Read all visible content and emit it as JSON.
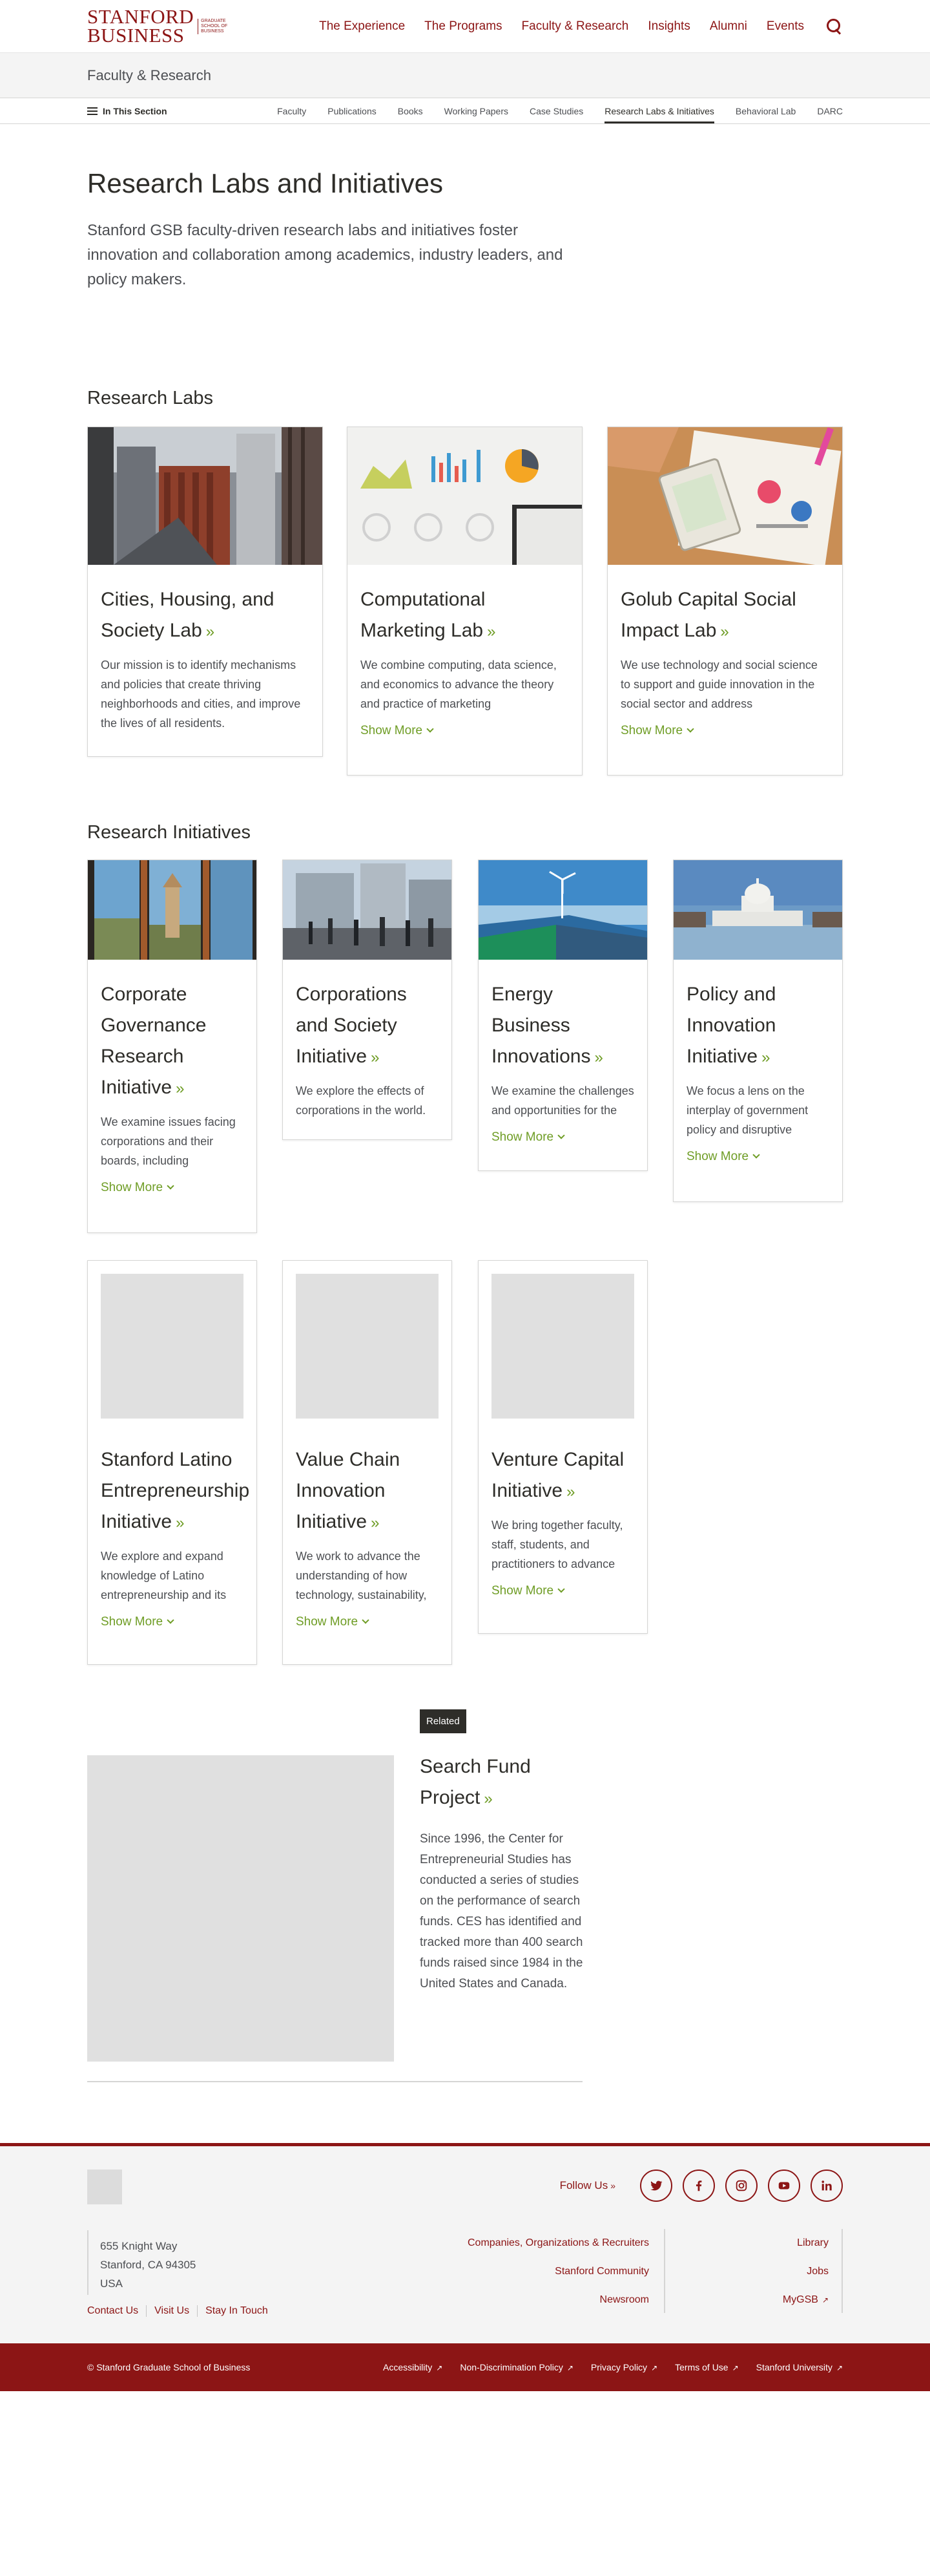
{
  "header": {
    "logo_line1": "STANFORD",
    "logo_line2": "BUSINESS",
    "logo_sub1": "Graduate",
    "logo_sub2": "School of",
    "logo_sub3": "Business",
    "nav": [
      "The Experience",
      "The Programs",
      "Faculty & Research",
      "Insights",
      "Alumni",
      "Events"
    ]
  },
  "section": {
    "title": "Faculty & Research"
  },
  "subnav": {
    "in_section": "In This Section",
    "links": [
      "Faculty",
      "Publications",
      "Books",
      "Working Papers",
      "Case Studies",
      "Research Labs & Initiatives",
      "Behavioral Lab",
      "DARC"
    ],
    "active_index": 5
  },
  "page": {
    "title": "Research Labs and Initiatives",
    "intro": "Stanford GSB faculty-driven research labs and initiatives foster innovation and collaboration among academics, industry leaders, and policy makers."
  },
  "labs": {
    "heading": "Research Labs",
    "items": [
      {
        "title": "Cities, Housing, and Society Lab",
        "text": "Our mission is to identify mechanisms and policies that create thriving neighborhoods and cities, and improve the lives of all residents.",
        "show_more": ""
      },
      {
        "title": "Computational Marketing Lab",
        "text": "We combine computing, data science, and economics to advance the theory and practice of marketing",
        "show_more": "Show More"
      },
      {
        "title": "Golub Capital Social Impact Lab",
        "text": "We use technology and social science to support and guide innovation in the social sector and address",
        "show_more": "Show More"
      }
    ]
  },
  "initiatives": {
    "heading": "Research Initiatives",
    "items": [
      {
        "title": "Corporate Governance Research Initiative",
        "text": "We examine issues facing corporations and their boards, including",
        "show_more": "Show More"
      },
      {
        "title": "Corporations and Society Initiative",
        "text": "We explore the effects of corporations in the world.",
        "show_more": ""
      },
      {
        "title": "Energy Business Innovations",
        "text": "We examine the challenges and opportunities for the",
        "show_more": "Show More"
      },
      {
        "title": "Policy and Innovation Initiative",
        "text": "We focus a lens on the interplay of government policy and disruptive",
        "show_more": "Show More"
      },
      {
        "title": "Stanford Latino Entrepreneurship Initiative",
        "text": "We explore and expand knowledge of Latino entrepreneurship and its",
        "show_more": "Show More"
      },
      {
        "title": "Value Chain Innovation Initiative",
        "text": "We work to advance the understanding of how technology, sustainability,",
        "show_more": "Show More"
      },
      {
        "title": "Venture Capital Initiative",
        "text": "We bring together faculty, staff, students, and practitioners to advance",
        "show_more": "Show More"
      }
    ]
  },
  "related": {
    "badge": "Related",
    "title": "Search Fund Project",
    "text": "Since 1996, the Center for Entrepreneurial Studies has conducted a series of studies on the performance of search funds. CES has identified and tracked more than 400 search funds raised since 1984 in the United States and Canada."
  },
  "footer": {
    "follow_label": "Follow Us",
    "social": [
      "twitter-icon",
      "facebook-icon",
      "instagram-icon",
      "youtube-icon",
      "linkedin-icon"
    ],
    "address": [
      "655 Knight Way",
      "Stanford, CA 94305",
      "USA"
    ],
    "left_links": [
      "Contact Us",
      "Visit Us",
      "Stay In Touch"
    ],
    "col1": [
      "Companies, Organizations & Recruiters",
      "Stanford Community",
      "Newsroom"
    ],
    "col2": [
      "Library",
      "Jobs",
      "MyGSB"
    ]
  },
  "bottom": {
    "copyright": "© Stanford Graduate School of Business",
    "links": [
      "Accessibility",
      "Non-Discrimination Policy",
      "Privacy Policy",
      "Terms of Use",
      "Stanford University"
    ]
  },
  "colors": {
    "brand": "#8c1515",
    "accent": "#6f9d26",
    "text": "#2e2d29"
  }
}
